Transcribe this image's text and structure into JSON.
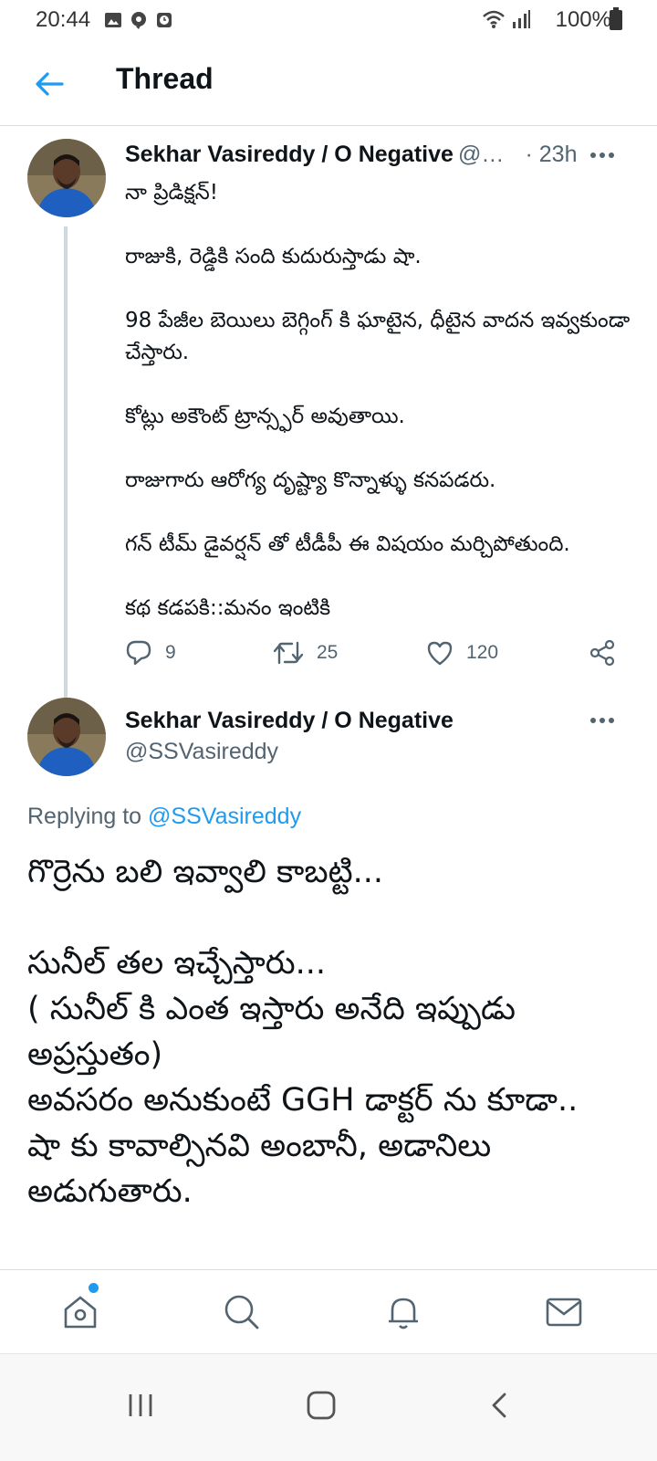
{
  "status_bar": {
    "time": "20:44",
    "battery": "100%"
  },
  "header": {
    "title": "Thread"
  },
  "tweet1": {
    "name": "Sekhar Vasireddy / O Negative",
    "handle": "@…",
    "time": "· 23h",
    "body": "నా ప్రిడిక్షన్!\n\nరాజుకి, రెడ్డికి సంది కుదురుస్తాడు షా.\n\n98 పేజీల బెయిలు బెగ్గింగ్ కి ఘాటైన, ధీటైన వాదన ఇవ్వకుండా చేస్తారు.\n\nకోట్లు అకౌంట్ ట్రాన్స్ఫర్ అవుతాయి.\n\nరాజుగారు ఆరోగ్య దృష్ట్యా కొన్నాళ్ళు కనపడరు.\n\nగన్ టీమ్ డైవర్షన్ తో టీడీపీ ఈ విషయం మర్చిపోతుంది.\n\nకథ కడపకి::మనం ఇంటికి",
    "replies": "9",
    "retweets": "25",
    "likes": "120"
  },
  "tweet2": {
    "name": "Sekhar Vasireddy / O Negative",
    "handle": "@SSVasireddy",
    "replying_prefix": "Replying to",
    "replying_to": "@SSVasireddy",
    "body": "గొర్రెను బలి ఇవ్వాలి కాబట్టి...\n\nసునీల్ తల ఇచ్చేస్తారు...\n( సునీల్ కి ఎంత ఇస్తారు అనేది ఇప్పుడు అప్రస్తుతం)\nఅవసరం అనుకుంటే GGH డాక్టర్ ను కూడా..\nషా కు కావాల్సినవి అంబానీ, అడానిలు అడుగుతారు."
  },
  "colors": {
    "accent": "#1d9bf0",
    "muted": "#536471",
    "divider": "#d9dde0"
  },
  "icons": {
    "back": "arrow-left-icon",
    "reply": "reply-icon",
    "retweet": "retweet-icon",
    "like": "heart-icon",
    "share": "share-icon",
    "home": "home-icon",
    "search": "search-icon",
    "notifications": "bell-icon",
    "messages": "mail-icon"
  }
}
